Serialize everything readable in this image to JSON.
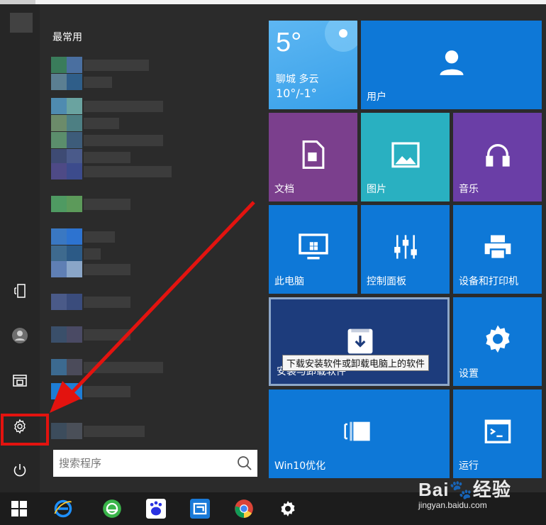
{
  "start_menu": {
    "most_used_header": "最常用",
    "search_placeholder": "搜索程序"
  },
  "tiles": {
    "weather": {
      "temp": "5°",
      "city": "聊城  多云",
      "range": "10°/-1°"
    },
    "user": "用户",
    "documents": "文档",
    "pictures": "图片",
    "music": "音乐",
    "this_pc": "此电脑",
    "control_panel": "控制面板",
    "devices_printers": "设备和打印机",
    "install_uninstall": "安装与卸载软件",
    "install_tooltip": "下载安装软件或卸载电脑上的软件",
    "settings": "设置",
    "win10_optimize": "Win10优化",
    "run": "运行"
  },
  "watermark": {
    "logo": "Bai🐾经验",
    "url": "jingyan.baidu.com"
  },
  "colors": {
    "accent": "#0e78d7",
    "purple": "#7b3f8d",
    "teal": "#29b0c1",
    "violet": "#6a3ea6",
    "dark_blue": "#1d3c7c",
    "highlight": "#e3130f"
  }
}
